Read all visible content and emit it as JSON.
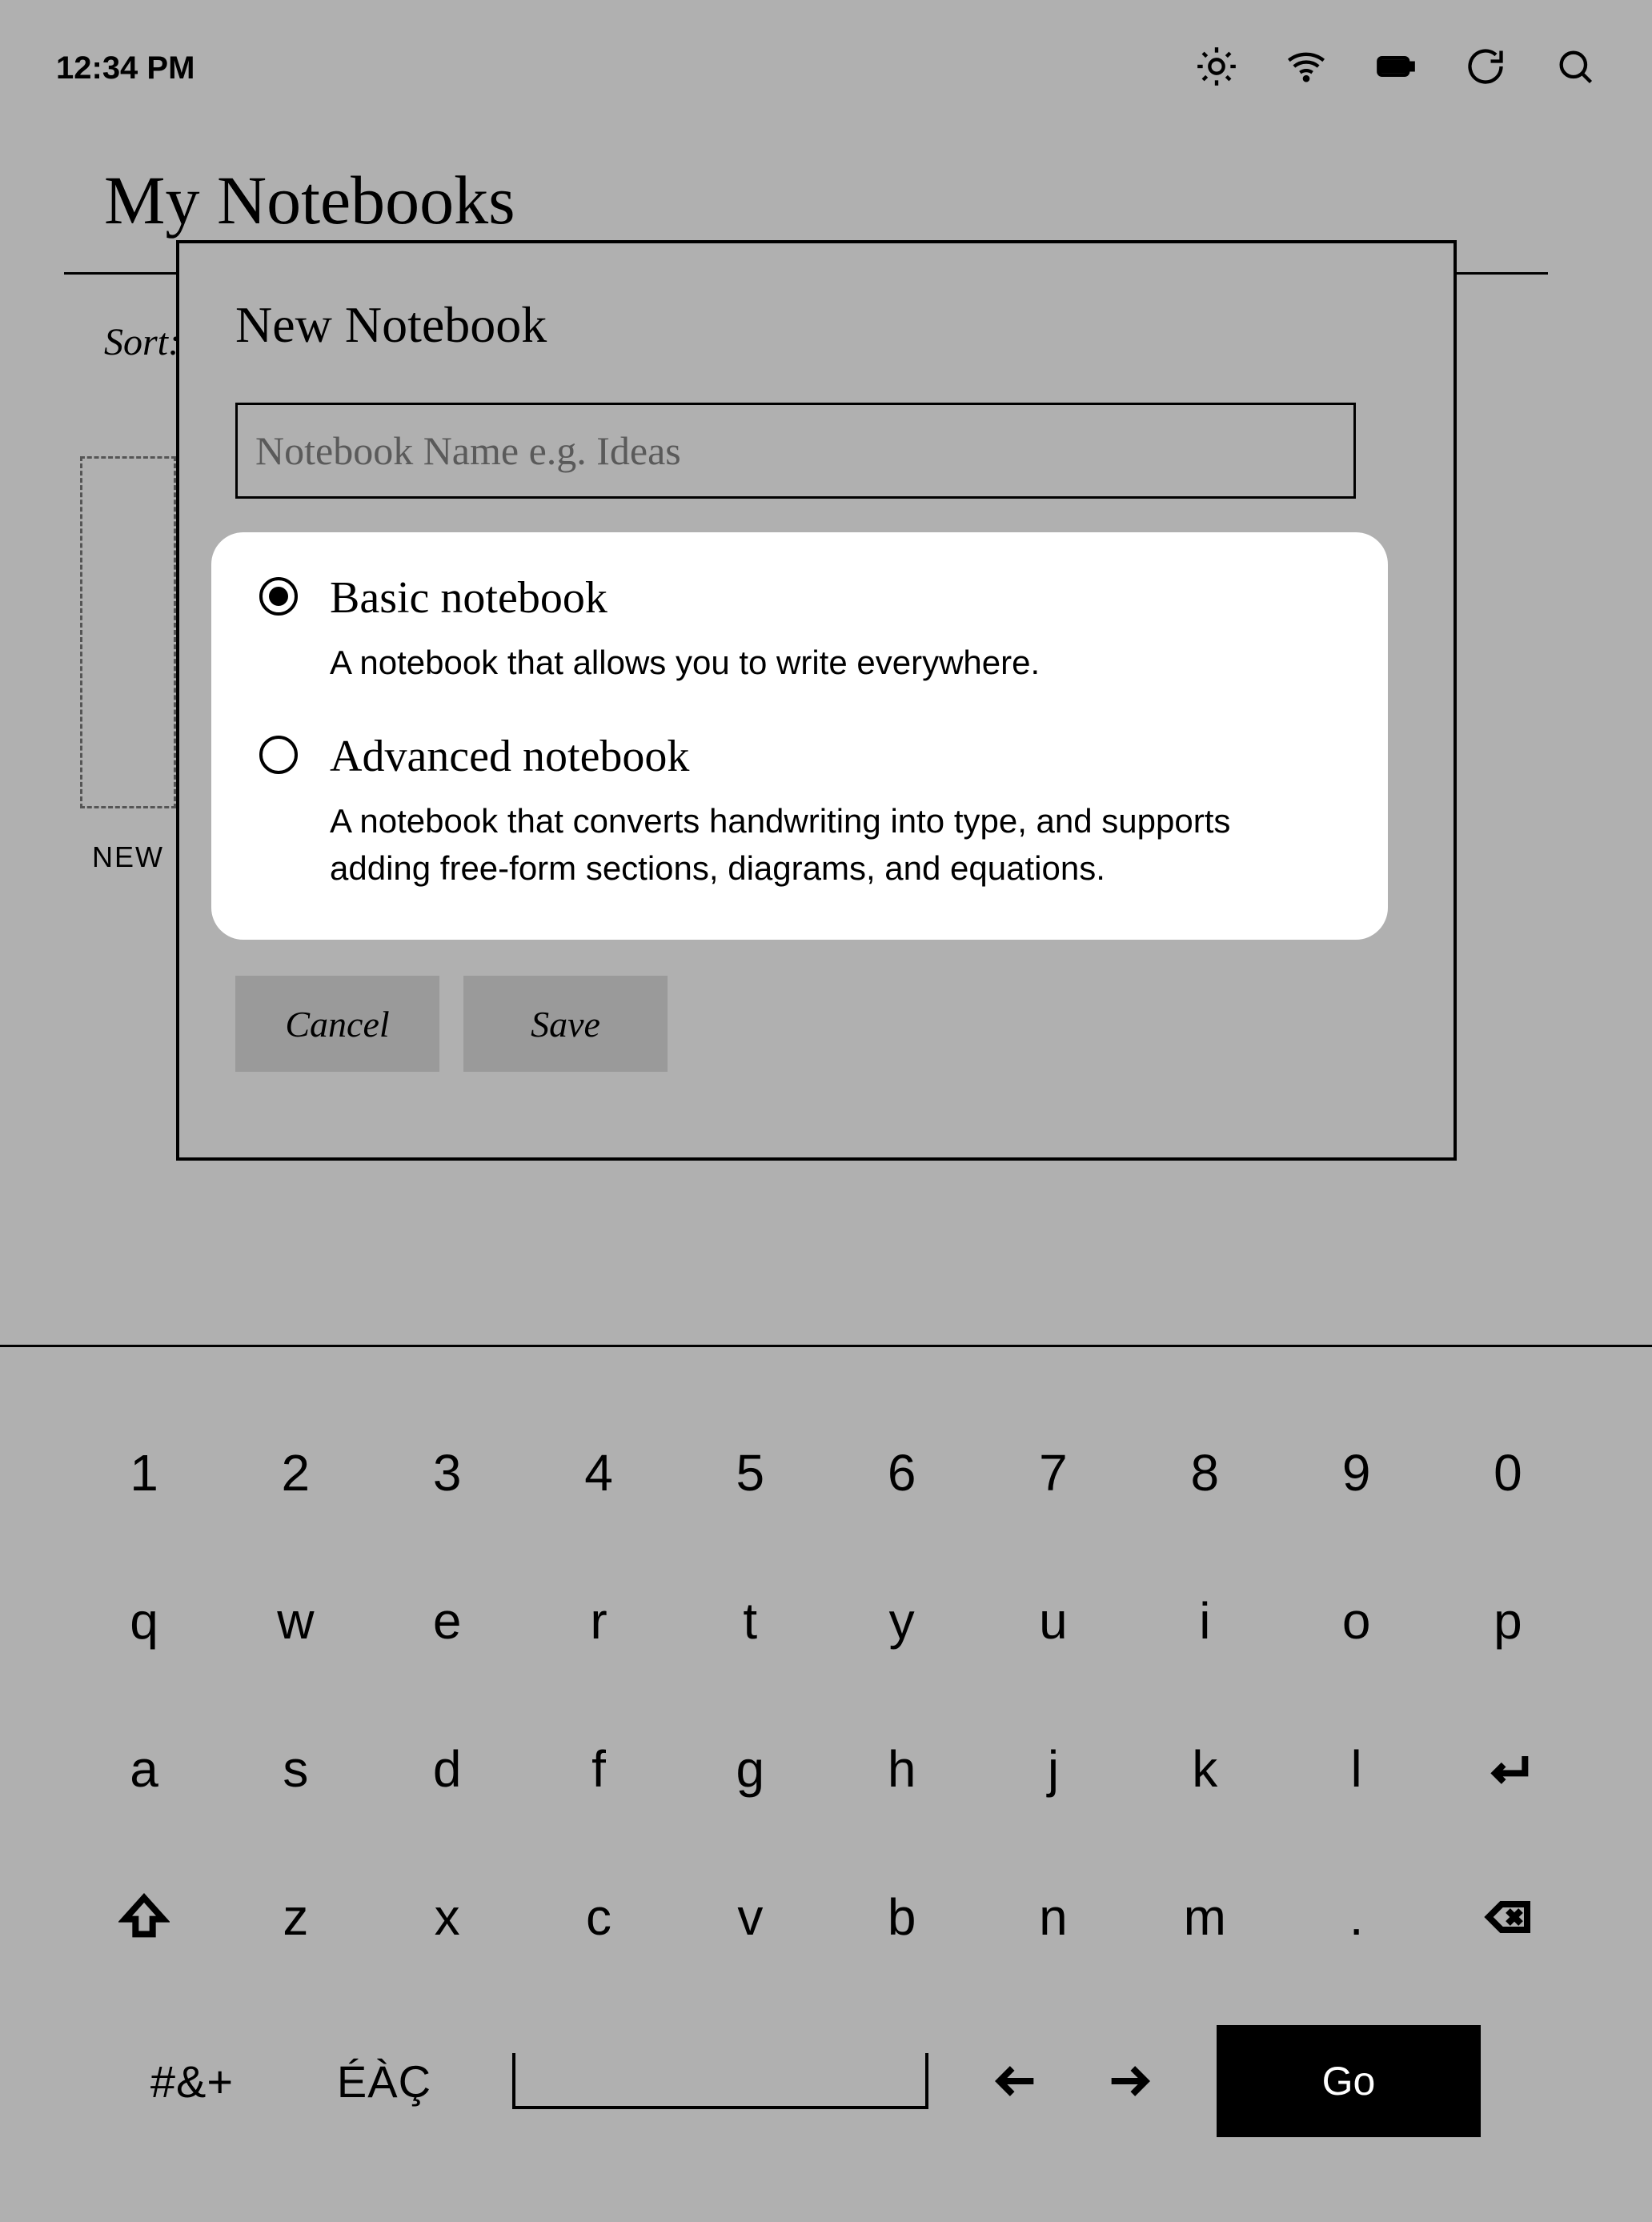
{
  "statusbar": {
    "time": "12:34 PM"
  },
  "page": {
    "title": "My Notebooks",
    "sort_label": "Sort:"
  },
  "grid": {
    "new_tile_label": "NEW"
  },
  "modal": {
    "title": "New Notebook",
    "name_placeholder": "Notebook Name e.g. Ideas",
    "name_value": "",
    "options": {
      "basic": {
        "title": "Basic notebook",
        "desc": "A notebook that allows you to write everywhere.",
        "selected": true
      },
      "advanced": {
        "title": "Advanced notebook",
        "desc": "A notebook that converts handwriting into type, and supports adding free-form sections, diagrams, and equations.",
        "selected": false
      }
    },
    "cancel": "Cancel",
    "save": "Save"
  },
  "keyboard": {
    "row1": [
      "1",
      "2",
      "3",
      "4",
      "5",
      "6",
      "7",
      "8",
      "9",
      "0"
    ],
    "row2": [
      "q",
      "w",
      "e",
      "r",
      "t",
      "y",
      "u",
      "i",
      "o",
      "p"
    ],
    "row3": [
      "a",
      "s",
      "d",
      "f",
      "g",
      "h",
      "j",
      "k",
      "l"
    ],
    "row4": [
      "z",
      "x",
      "c",
      "v",
      "b",
      "n",
      "m",
      "."
    ],
    "sym": "#&+",
    "accent": "ÉÀÇ",
    "go": "Go"
  }
}
